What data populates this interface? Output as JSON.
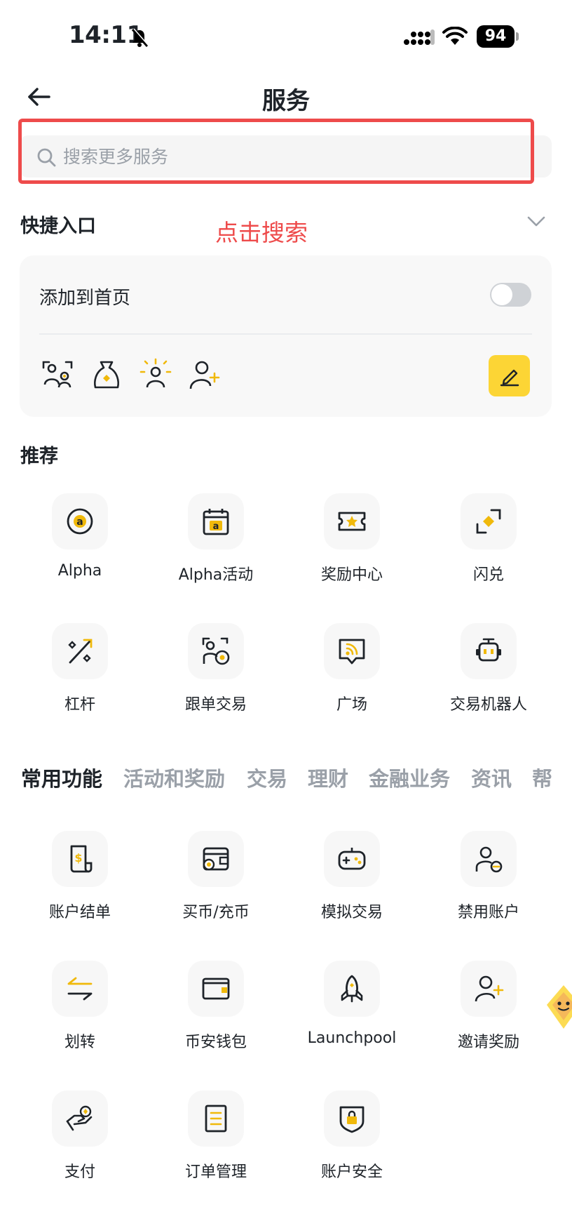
{
  "status_bar": {
    "time": "14:11",
    "battery": "94"
  },
  "header": {
    "title": "服务"
  },
  "search": {
    "placeholder": "搜索更多服务"
  },
  "annotation": "点击搜索",
  "quick_entry": {
    "title": "快捷入口",
    "add_to_home_label": "添加到首页",
    "toggle_on": false,
    "icons": [
      "user-group-icon",
      "money-bag-icon",
      "sun-person-icon",
      "add-user-icon"
    ]
  },
  "recommend": {
    "title": "推荐",
    "items": [
      {
        "label": "Alpha",
        "icon": "alpha-icon"
      },
      {
        "label": "Alpha活动",
        "icon": "alpha-calendar-icon"
      },
      {
        "label": "奖励中心",
        "icon": "ticket-icon"
      },
      {
        "label": "闪兑",
        "icon": "convert-icon"
      },
      {
        "label": "杠杆",
        "icon": "percent-icon"
      },
      {
        "label": "跟单交易",
        "icon": "copy-trade-icon"
      },
      {
        "label": "广场",
        "icon": "feed-icon"
      },
      {
        "label": "交易机器人",
        "icon": "robot-icon"
      }
    ]
  },
  "tabs": [
    "常用功能",
    "活动和奖励",
    "交易",
    "理财",
    "金融业务",
    "资讯",
    "帮"
  ],
  "common": {
    "items": [
      {
        "label": "账户结单",
        "icon": "statement-icon"
      },
      {
        "label": "买币/充币",
        "icon": "buy-crypto-icon"
      },
      {
        "label": "模拟交易",
        "icon": "gamepad-icon"
      },
      {
        "label": "禁用账户",
        "icon": "disable-account-icon"
      },
      {
        "label": "划转",
        "icon": "transfer-icon"
      },
      {
        "label": "币安钱包",
        "icon": "wallet-icon"
      },
      {
        "label": "Launchpool",
        "icon": "rocket-icon"
      },
      {
        "label": "邀请奖励",
        "icon": "invite-icon"
      },
      {
        "label": "支付",
        "icon": "pay-icon"
      },
      {
        "label": "订单管理",
        "icon": "order-icon"
      },
      {
        "label": "账户安全",
        "icon": "shield-lock-icon"
      }
    ]
  },
  "colors": {
    "accent": "#FCD535",
    "icon_yellow": "#F0B90B",
    "highlight_red": "#EE4B4B",
    "tile_bg": "#F7F7F7"
  }
}
